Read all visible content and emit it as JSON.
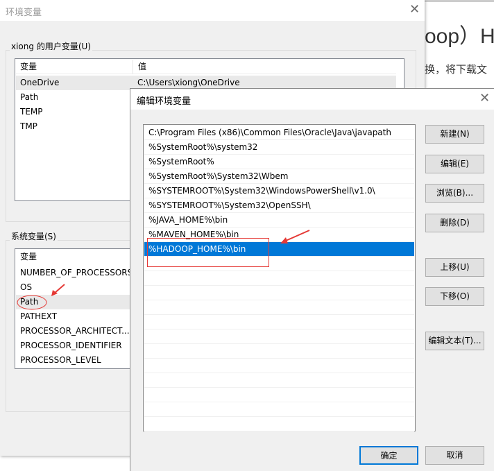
{
  "background_page": {
    "heading": "oop）HA",
    "text": "换，将下载文"
  },
  "env_dialog": {
    "title": "环境变量",
    "user_group": "xiong 的用户变量(U)",
    "user_columns": [
      "变量",
      "值"
    ],
    "user_vars": [
      {
        "name": "OneDrive",
        "value": "C:\\Users\\xiong\\OneDrive"
      },
      {
        "name": "Path",
        "value": ""
      },
      {
        "name": "TEMP",
        "value": ""
      },
      {
        "name": "TMP",
        "value": ""
      }
    ],
    "system_group": "系统变量(S)",
    "system_column": "变量",
    "system_vars": [
      "NUMBER_OF_PROCESSORS",
      "OS",
      "Path",
      "PATHEXT",
      "PROCESSOR_ARCHITECT...",
      "PROCESSOR_IDENTIFIER",
      "PROCESSOR_LEVEL"
    ]
  },
  "edit_dialog": {
    "title": "编辑环境变量",
    "entries": [
      "C:\\Program Files (x86)\\Common Files\\Oracle\\Java\\javapath",
      "%SystemRoot%\\system32",
      "%SystemRoot%",
      "%SystemRoot%\\System32\\Wbem",
      "%SYSTEMROOT%\\System32\\WindowsPowerShell\\v1.0\\",
      "%SYSTEMROOT%\\System32\\OpenSSH\\",
      "%JAVA_HOME%\\bin",
      "%MAVEN_HOME%\\bin",
      "%HADOOP_HOME%\\bin"
    ],
    "selected_index": 8,
    "buttons": {
      "new": "新建(N)",
      "edit": "编辑(E)",
      "browse": "浏览(B)...",
      "delete": "删除(D)",
      "up": "上移(U)",
      "down": "下移(O)",
      "edit_text": "编辑文本(T)...",
      "ok": "确定",
      "cancel": "取消"
    }
  },
  "colors": {
    "selection": "#0078d7",
    "annotation": "#e53935"
  }
}
